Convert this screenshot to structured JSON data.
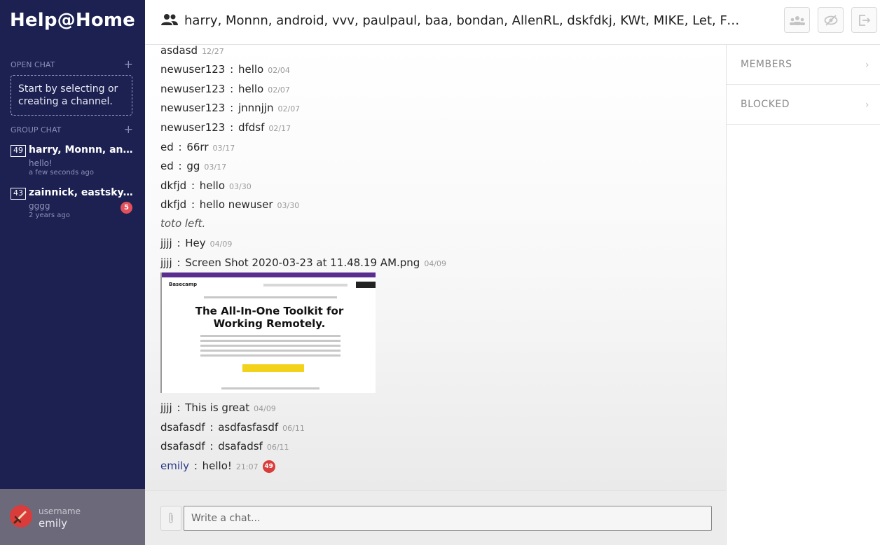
{
  "sidebar": {
    "logo": "Help@Home",
    "open_chat": {
      "heading": "OPEN CHAT",
      "add_symbol": "+",
      "empty_text": "Start by selecting or creating a channel."
    },
    "group_chat": {
      "heading": "GROUP CHAT",
      "add_symbol": "+",
      "items": [
        {
          "count": "49",
          "name": "harry, Monnn, and...",
          "last_message": "hello!",
          "time": "a few seconds ago",
          "unread": ""
        },
        {
          "count": "43",
          "name": "zainnick, eastsky, ...",
          "last_message": "gggg",
          "time": "2 years ago",
          "unread": "5"
        }
      ]
    },
    "user": {
      "label": "username",
      "name": "emily"
    }
  },
  "header": {
    "title": "harry, Monnn, android, vvv, paulpaul, baa, bondan, AllenRL, dskfdkj, KWt, MIKE, Let, Foz..."
  },
  "messages": [
    {
      "sender": "asdasd",
      "text": "",
      "date": "12/27"
    },
    {
      "sender": "newuser123",
      "text": "hello",
      "date": "02/04"
    },
    {
      "sender": "newuser123",
      "text": "hello",
      "date": "02/07"
    },
    {
      "sender": "newuser123",
      "text": "jnnnjjn",
      "date": "02/07"
    },
    {
      "sender": "newuser123",
      "text": "dfdsf",
      "date": "02/17"
    },
    {
      "sender": "ed",
      "text": "66rr",
      "date": "03/17"
    },
    {
      "sender": "ed",
      "text": "gg",
      "date": "03/17"
    },
    {
      "sender": "dkfjd",
      "text": "hello",
      "date": "03/30"
    },
    {
      "sender": "dkfjd",
      "text": "hello newuser",
      "date": "03/30"
    },
    {
      "system": "toto left."
    },
    {
      "sender": "jjjj",
      "text": "Hey",
      "date": "04/09"
    },
    {
      "sender": "jjjj",
      "text": "Screen Shot 2020-03-23 at 11.48.19 AM.png",
      "date": "04/09"
    },
    {
      "sender": "jjjj",
      "text": "This is great",
      "date": "04/09"
    },
    {
      "sender": "dsafasdf",
      "text": "asdfasfasdf",
      "date": "06/11"
    },
    {
      "sender": "dsafasdf",
      "text": "dsafadsf",
      "date": "06/11"
    },
    {
      "sender": "emily",
      "text": "hello!",
      "date": "21:07",
      "badge": "49"
    }
  ],
  "attachment": {
    "logo": "Basecamp",
    "headline_1": "The All-In-One Toolkit for",
    "headline_2": "Working Remotely."
  },
  "right_panel": {
    "items": [
      {
        "label": "MEMBERS",
        "chevron": "›"
      },
      {
        "label": "BLOCKED",
        "chevron": "›"
      }
    ]
  },
  "composer": {
    "placeholder": "Write a chat...",
    "value": ""
  },
  "icons": {
    "group": "group-icon",
    "members_button": "people-icon",
    "hide_button": "eye-off-icon",
    "leave_button": "exit-icon",
    "attach": "paperclip-icon"
  },
  "colors": {
    "sidebar_bg": "#1c2152",
    "unread_badge": "#e2505b",
    "self_name": "#2a3a8c",
    "avatar": "#d93c3a"
  }
}
